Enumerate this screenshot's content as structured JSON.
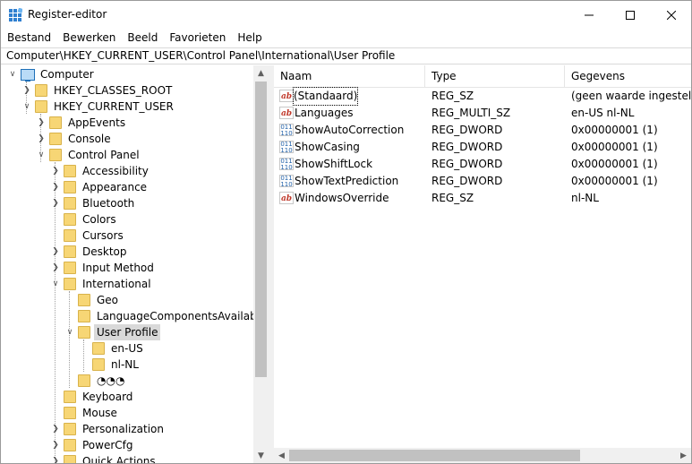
{
  "window": {
    "title": "Register-editor",
    "icons": {
      "app": "registry-editor-icon",
      "minimize": "minimize-icon",
      "maximize": "maximize-icon",
      "close": "close-icon"
    }
  },
  "menu": [
    "Bestand",
    "Bewerken",
    "Beeld",
    "Favorieten",
    "Help"
  ],
  "address": "Computer\\HKEY_CURRENT_USER\\Control Panel\\International\\User Profile",
  "tree": {
    "root": "Computer",
    "hives": [
      "HKEY_CLASSES_ROOT",
      "HKEY_CURRENT_USER"
    ],
    "hkcu_children": [
      "AppEvents",
      "Console",
      "Control Panel"
    ],
    "control_panel_children": [
      "Accessibility",
      "Appearance",
      "Bluetooth",
      "Colors",
      "Cursors",
      "Desktop",
      "Input Method",
      "International"
    ],
    "international_children": [
      "Geo",
      "LanguageComponentsAvailable",
      "User Profile"
    ],
    "user_profile_children": [
      "en-US",
      "nl-NL"
    ],
    "unnamed_key": "◔◔◔",
    "control_panel_more": [
      "Keyboard",
      "Mouse",
      "Personalization",
      "PowerCfg",
      "Quick Actions"
    ],
    "selected": "User Profile"
  },
  "list": {
    "columns": [
      "Naam",
      "Type",
      "Gegevens"
    ],
    "rows": [
      {
        "name": "(Standaard)",
        "type": "REG_SZ",
        "data": "(geen waarde ingesteld)",
        "icon": "string-value-icon"
      },
      {
        "name": "Languages",
        "type": "REG_MULTI_SZ",
        "data": "en-US nl-NL",
        "icon": "string-value-icon"
      },
      {
        "name": "ShowAutoCorrection",
        "type": "REG_DWORD",
        "data": "0x00000001 (1)",
        "icon": "binary-value-icon"
      },
      {
        "name": "ShowCasing",
        "type": "REG_DWORD",
        "data": "0x00000001 (1)",
        "icon": "binary-value-icon"
      },
      {
        "name": "ShowShiftLock",
        "type": "REG_DWORD",
        "data": "0x00000001 (1)",
        "icon": "binary-value-icon"
      },
      {
        "name": "ShowTextPrediction",
        "type": "REG_DWORD",
        "data": "0x00000001 (1)",
        "icon": "binary-value-icon"
      },
      {
        "name": "WindowsOverride",
        "type": "REG_SZ",
        "data": "nl-NL",
        "icon": "string-value-icon"
      }
    ]
  }
}
